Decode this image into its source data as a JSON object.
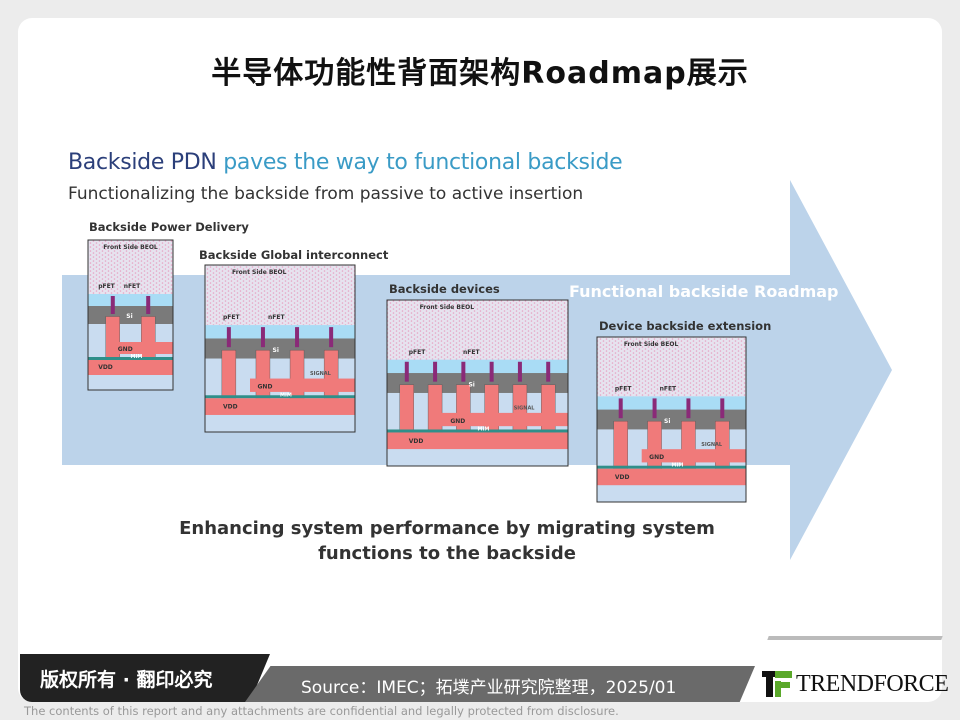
{
  "title": "半导体功能性背面架构Roadmap展示",
  "figure": {
    "heading_part1": "Backside PDN",
    "heading_part2": "paves the way to functional backside",
    "subheading": "Functionalizing the backside from passive to active insertion",
    "roadmap_label": "Functional backside Roadmap",
    "bottom_line1": "Enhancing system performance by migrating system",
    "bottom_line2": "functions to the backside",
    "layer_labels": {
      "beol": "Front Side BEOL",
      "pfet": "pFET",
      "nfet": "nFET",
      "si": "Si",
      "vdd": "VDD",
      "gnd": "GND",
      "mim": "MIM",
      "signal": "SIGNAL"
    },
    "panels": [
      {
        "label": "Backside Power Delivery"
      },
      {
        "label": "Backside Global interconnect"
      },
      {
        "label": "Backside devices"
      },
      {
        "label": "Device backside extension"
      }
    ],
    "colors": {
      "arrow": "#bcd3ea",
      "metal": "#f07a7a",
      "si": "#7a7a7a",
      "teal": "#2f8f8a"
    }
  },
  "footer": {
    "copyright": "版权所有 · 翻印必究",
    "source": "Source：IMEC；拓墣产业研究院整理，2025/01",
    "logo": "TRENDFORCE",
    "disclaimer": "The contents of this report and any attachments are confidential and legally protected from disclosure."
  }
}
